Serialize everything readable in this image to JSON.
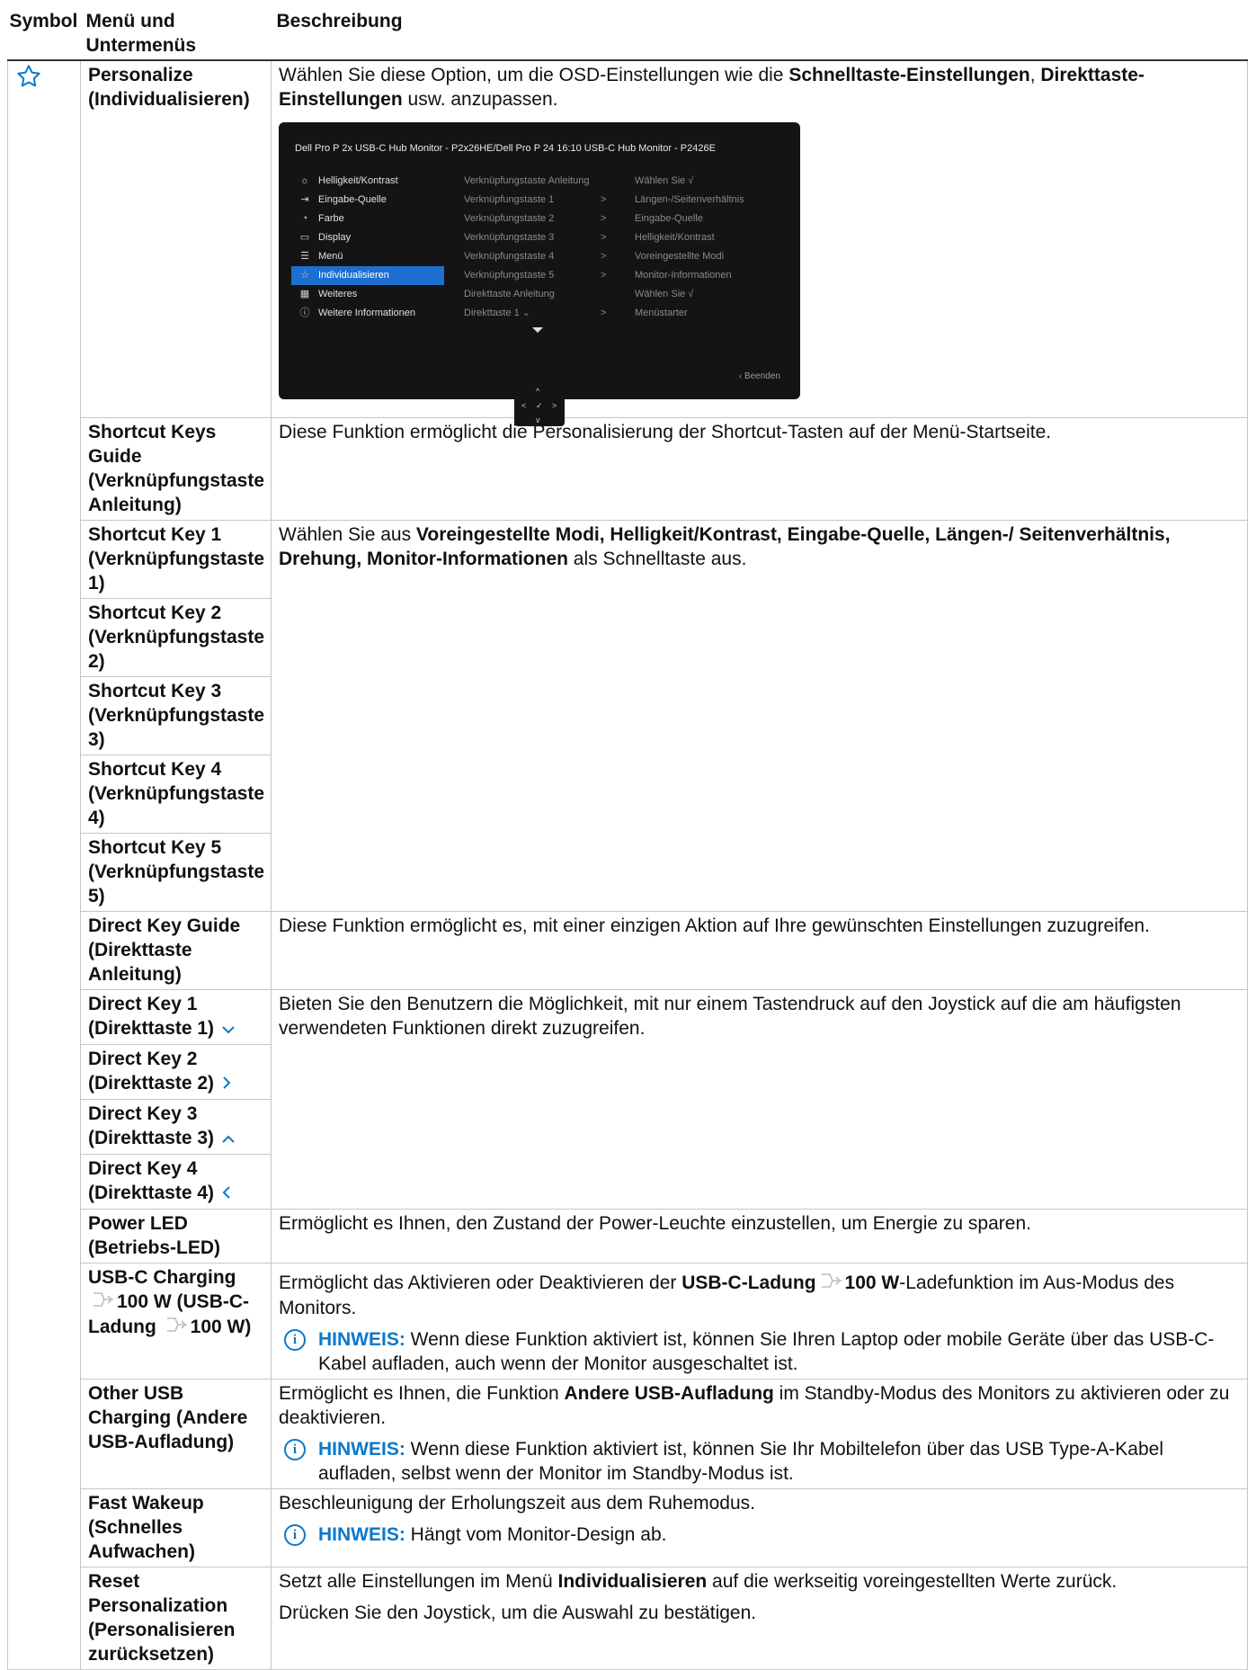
{
  "header": {
    "symbol": "Symbol",
    "menu": "Menü und Untermenüs",
    "description": "Beschreibung"
  },
  "icons": {
    "personalize": "star-icon",
    "note": "info-circle-icon",
    "usb_power": "power-plug-icon",
    "direct_keys": [
      "chevron-down-icon",
      "chevron-right-icon",
      "chevron-up-icon",
      "chevron-left-icon"
    ]
  },
  "colors": {
    "accent_blue": "#0b78c9",
    "osd_background": "#141414",
    "osd_selected": "#1d6fd0"
  },
  "rows": {
    "personalize": {
      "menu": "Personalize (Individualisieren)",
      "desc_a": "Wählen Sie diese Option, um die OSD-Einstellungen wie die ",
      "desc_b": "Schnelltaste-Einstellungen",
      "desc_c": ", ",
      "desc_d": "Direkttaste-Einstellungen",
      "desc_e": " usw. anzupassen."
    },
    "shortcut_guide": {
      "menu": "Shortcut Keys Guide (Verknüpfungstaste Anleitung)",
      "desc": "Diese Funktion ermöglicht die Personalisierung der Shortcut-Tasten auf der Menü-Startseite."
    },
    "shortcut_keys": {
      "items": [
        "Shortcut Key 1 (Verknüpfungstaste 1)",
        "Shortcut Key 2 (Verknüpfungstaste 2)",
        "Shortcut Key 3 (Verknüpfungstaste 3)",
        "Shortcut Key 4 (Verknüpfungstaste 4)",
        "Shortcut Key 5 (Verknüpfungstaste 5)"
      ],
      "desc_a": "Wählen Sie aus ",
      "desc_b": "Voreingestellte Modi, Helligkeit/Kontrast, Eingabe-Quelle, Längen-/ Seitenverhältnis, Drehung, Monitor-Informationen",
      "desc_c": " als Schnelltaste aus."
    },
    "direct_guide": {
      "menu": "Direct Key Guide (Direkttaste Anleitung)",
      "desc": "Diese Funktion ermöglicht es, mit einer einzigen Aktion auf Ihre gewünschten Einstellungen zuzugreifen."
    },
    "direct_keys": {
      "items": [
        {
          "line1": "Direct Key 1",
          "line2": "(Direkttaste 1)"
        },
        {
          "line1": "Direct Key 2",
          "line2": "(Direkttaste 2)"
        },
        {
          "line1": "Direct Key 3",
          "line2": "(Direkttaste 3)"
        },
        {
          "line1": "Direct Key 4",
          "line2": "(Direkttaste 4)"
        }
      ],
      "desc": "Bieten Sie den Benutzern die Möglichkeit, mit nur einem Tastendruck auf den Joystick auf die am häufigsten verwendeten Funktionen direkt zuzugreifen."
    },
    "power_led": {
      "menu": "Power LED (Betriebs-LED)",
      "desc": "Ermöglicht es Ihnen, den Zustand der Power-Leuchte einzustellen, um Energie zu sparen."
    },
    "usbc_charging": {
      "menu_a": "USB-C Charging",
      "menu_b": "100 W (USB-C-Ladung",
      "menu_c": "100 W)",
      "desc_a": "Ermöglicht das Aktivieren oder Deaktivieren der ",
      "desc_b": "USB-C-Ladung",
      "desc_c": "100 W",
      "desc_d": "-Ladefunktion im Aus-Modus des Monitors.",
      "note_label": "HINWEIS:",
      "note": " Wenn diese Funktion aktiviert ist, können Sie Ihren Laptop oder mobile Geräte über das USB-C-Kabel aufladen, auch wenn der Monitor ausgeschaltet ist."
    },
    "other_usb": {
      "menu": "Other USB Charging (Andere USB-Aufladung)",
      "desc_a": "Ermöglicht es Ihnen, die Funktion ",
      "desc_b": "Andere USB-Aufladung",
      "desc_c": " im Standby-Modus des Monitors zu aktivieren oder zu deaktivieren.",
      "note_label": "HINWEIS:",
      "note": " Wenn diese Funktion aktiviert ist, können Sie Ihr Mobiltelefon über das USB Type-A-Kabel aufladen, selbst wenn der Monitor im Standby-Modus ist."
    },
    "fast_wakeup": {
      "menu": "Fast Wakeup (Schnelles Aufwachen)",
      "desc": "Beschleunigung der Erholungszeit aus dem Ruhemodus.",
      "note_label": "HINWEIS:",
      "note": " Hängt vom Monitor-Design ab."
    },
    "reset": {
      "menu": "Reset Personalization (Personalisieren zurücksetzen)",
      "desc_a": "Setzt alle Einstellungen im Menü ",
      "desc_b": "Individualisieren",
      "desc_c": " auf die werkseitig voreingestellten Werte zurück.",
      "desc2": "Drücken Sie den Joystick, um die Auswahl zu bestätigen."
    }
  },
  "osd": {
    "title": "Dell Pro P 2x USB-C Hub Monitor - P2x26HE/Dell Pro P 24 16:10 USB-C Hub Monitor - P2426E",
    "left": [
      {
        "icon": "brightness-icon",
        "glyph": "☼",
        "label": "Helligkeit/Kontrast"
      },
      {
        "icon": "input-source-icon",
        "glyph": "⇥",
        "label": "Eingabe-Quelle"
      },
      {
        "icon": "palette-icon",
        "glyph": "◔",
        "label": "Farbe"
      },
      {
        "icon": "display-icon",
        "glyph": "▭",
        "label": "Display"
      },
      {
        "icon": "menu-icon",
        "glyph": "☰",
        "label": "Menü"
      },
      {
        "icon": "star-icon",
        "glyph": "☆",
        "label": "Individualisieren"
      },
      {
        "icon": "others-icon",
        "glyph": "▦",
        "label": "Weiteres"
      },
      {
        "icon": "info-icon",
        "glyph": "ⓘ",
        "label": "Weitere Informationen"
      }
    ],
    "selected_index": 5,
    "middle": [
      "Verknüpfungstaste Anleitung",
      "Verknüpfungstaste 1",
      "Verknüpfungstaste 2",
      "Verknüpfungstaste 3",
      "Verknüpfungstaste 4",
      "Verknüpfungstaste 5",
      "Direkttaste Anleitung",
      "Direkttaste 1 ⌄"
    ],
    "arrows": [
      "",
      ">",
      ">",
      ">",
      ">",
      ">",
      "",
      ">"
    ],
    "right": [
      "Wählen Sie √",
      "Längen-/Seitenverhältnis",
      "Eingabe-Quelle",
      "Helligkeit/Kontrast",
      "Voreingestellte Modi",
      "Monitor-Informationen",
      "Wählen Sie √",
      "Menüstarter"
    ],
    "exit": "‹ Beenden",
    "joystick": {
      "up": "^",
      "down": "v",
      "left": "<",
      "right": ">",
      "center": "✓"
    }
  }
}
